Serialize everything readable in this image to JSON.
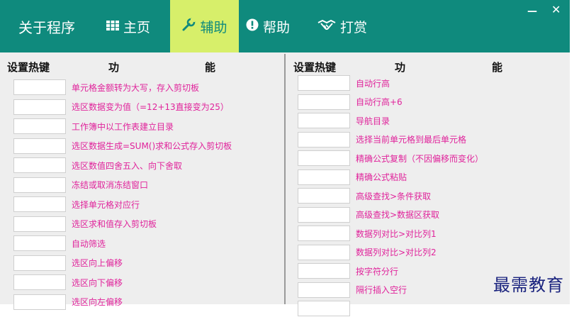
{
  "titlebar": {
    "about": "关于程序",
    "home": "主页",
    "assist": "辅助",
    "help": "帮助",
    "reward": "打赏",
    "min_glyph": "—",
    "close_glyph": "✕"
  },
  "icons": {
    "home": "grid-icon",
    "assist": "wrench-icon",
    "help": "info-icon",
    "reward": "handshake-icon"
  },
  "colors": {
    "header_bg": "#0f8a7d",
    "active_tab_bg": "#d7ef6a",
    "function_text": "#e0239b"
  },
  "left": {
    "hdr_hotkey": "设置热键",
    "hdr_func_a": "功",
    "hdr_func_b": "能",
    "items": [
      "单元格金额转为大写，存入剪切板",
      "选区数据变为值（=12+13直接变为25）",
      "工作簿中以工作表建立目录",
      "选区数据生成=SUM()求和公式存入剪切板",
      "选区数值四舍五入、向下舍取",
      "冻结或取消冻结窗口",
      "选择单元格对应行",
      "选区求和值存入剪切板",
      "自动筛选",
      "选区向上偏移",
      "选区向下偏移",
      "选区向左偏移"
    ]
  },
  "right": {
    "hdr_hotkey": "设置热键",
    "hdr_func_a": "功",
    "hdr_func_b": "能",
    "items": [
      "自动行高",
      "自动行高+6",
      "导航目录",
      "选择当前单元格到最后单元格",
      "精确公式复制（不因偏移而变化）",
      "精确公式粘贴",
      "高级查找>条件获取",
      "高级查找>数据区获取",
      "数据列对比>对比列1",
      "数据列对比>对比列2",
      "按字符分行",
      "隔行插入空行",
      ""
    ]
  },
  "watermark": "最需教育"
}
